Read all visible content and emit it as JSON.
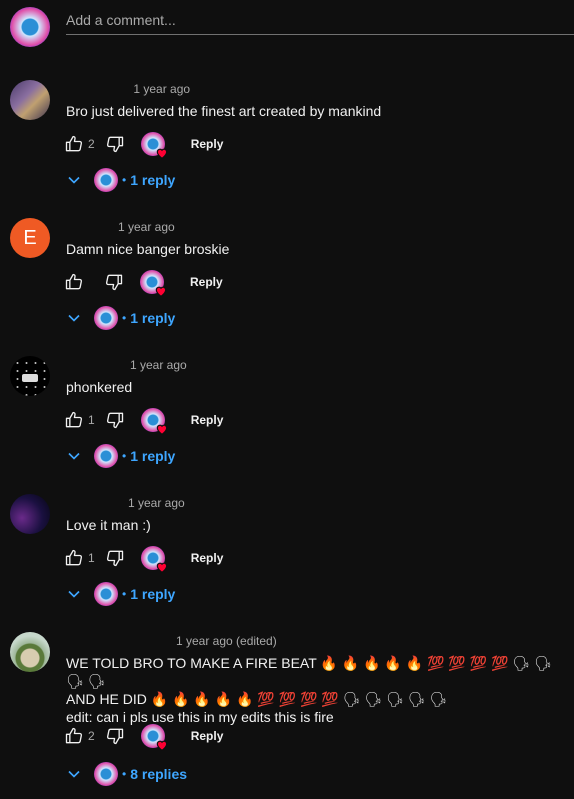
{
  "add_comment": {
    "placeholder": "Add a comment..."
  },
  "comments": [
    {
      "author": "",
      "time": "1 year ago",
      "text": "Bro just delivered the finest art created by mankind",
      "likes": "2",
      "reply_label": "Reply",
      "replies_label": "1 reply"
    },
    {
      "author": "",
      "avatar_letter": "E",
      "time": "1 year ago",
      "text": "Damn nice banger broskie",
      "likes": "",
      "reply_label": "Reply",
      "replies_label": "1 reply"
    },
    {
      "author": "",
      "time": "1 year ago",
      "text": "phonkered",
      "likes": "1",
      "reply_label": "Reply",
      "replies_label": "1 reply"
    },
    {
      "author": "",
      "time": "1 year ago",
      "text": "Love it man :)",
      "likes": "1",
      "reply_label": "Reply",
      "replies_label": "1 reply"
    },
    {
      "author": "",
      "time": "1 year ago (edited)",
      "text": "WE TOLD BRO TO MAKE A FIRE BEAT 🔥 🔥 🔥 🔥 🔥 💯 💯 💯 💯 🗣 🗣 🗣 🗣\nAND HE DID 🔥 🔥 🔥 🔥 🔥 💯 💯 💯 💯 🗣 🗣 🗣 🗣 🗣\nedit: can i pls use this in my edits this is fire",
      "likes": "2",
      "reply_label": "Reply",
      "replies_label": "8 replies"
    }
  ],
  "colors": {
    "background": "#0f0f0f",
    "link": "#3ea6ff",
    "heart": "#ff0033"
  }
}
